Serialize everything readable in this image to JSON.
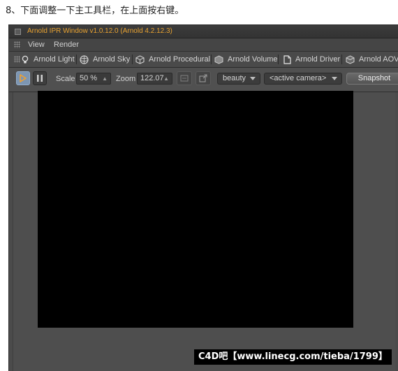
{
  "caption": "8、下面调整一下主工具栏，在上面按右键。",
  "window": {
    "title": "Arnold IPR Window v1.0.12.0 (Arnold 4.2.12.3)",
    "title_color": "#e8a230"
  },
  "menu": {
    "items": [
      "View",
      "Render"
    ]
  },
  "object_bar": {
    "items": [
      {
        "label": "Arnold Light",
        "icon": "lightbulb-icon"
      },
      {
        "label": "Arnold Sky",
        "icon": "sky-sphere-icon"
      },
      {
        "label": "Arnold Procedural",
        "icon": "procedural-cube-icon"
      },
      {
        "label": "Arnold Volume",
        "icon": "volume-cube-icon"
      },
      {
        "label": "Arnold Driver",
        "icon": "document-icon"
      },
      {
        "label": "Arnold AOV",
        "icon": "aov-box-icon"
      }
    ]
  },
  "toolbar": {
    "scale_label": "Scale",
    "scale_value": "50 %",
    "zoom_label": "Zoom",
    "zoom_value": "122.07",
    "pass_value": "beauty",
    "camera_value": "<active camera>",
    "snapshot_label": "Snapshot",
    "accent_color": "#7d96b2"
  },
  "watermark": {
    "text": "C4D吧【www.linecg.com/tieba/1799】"
  }
}
